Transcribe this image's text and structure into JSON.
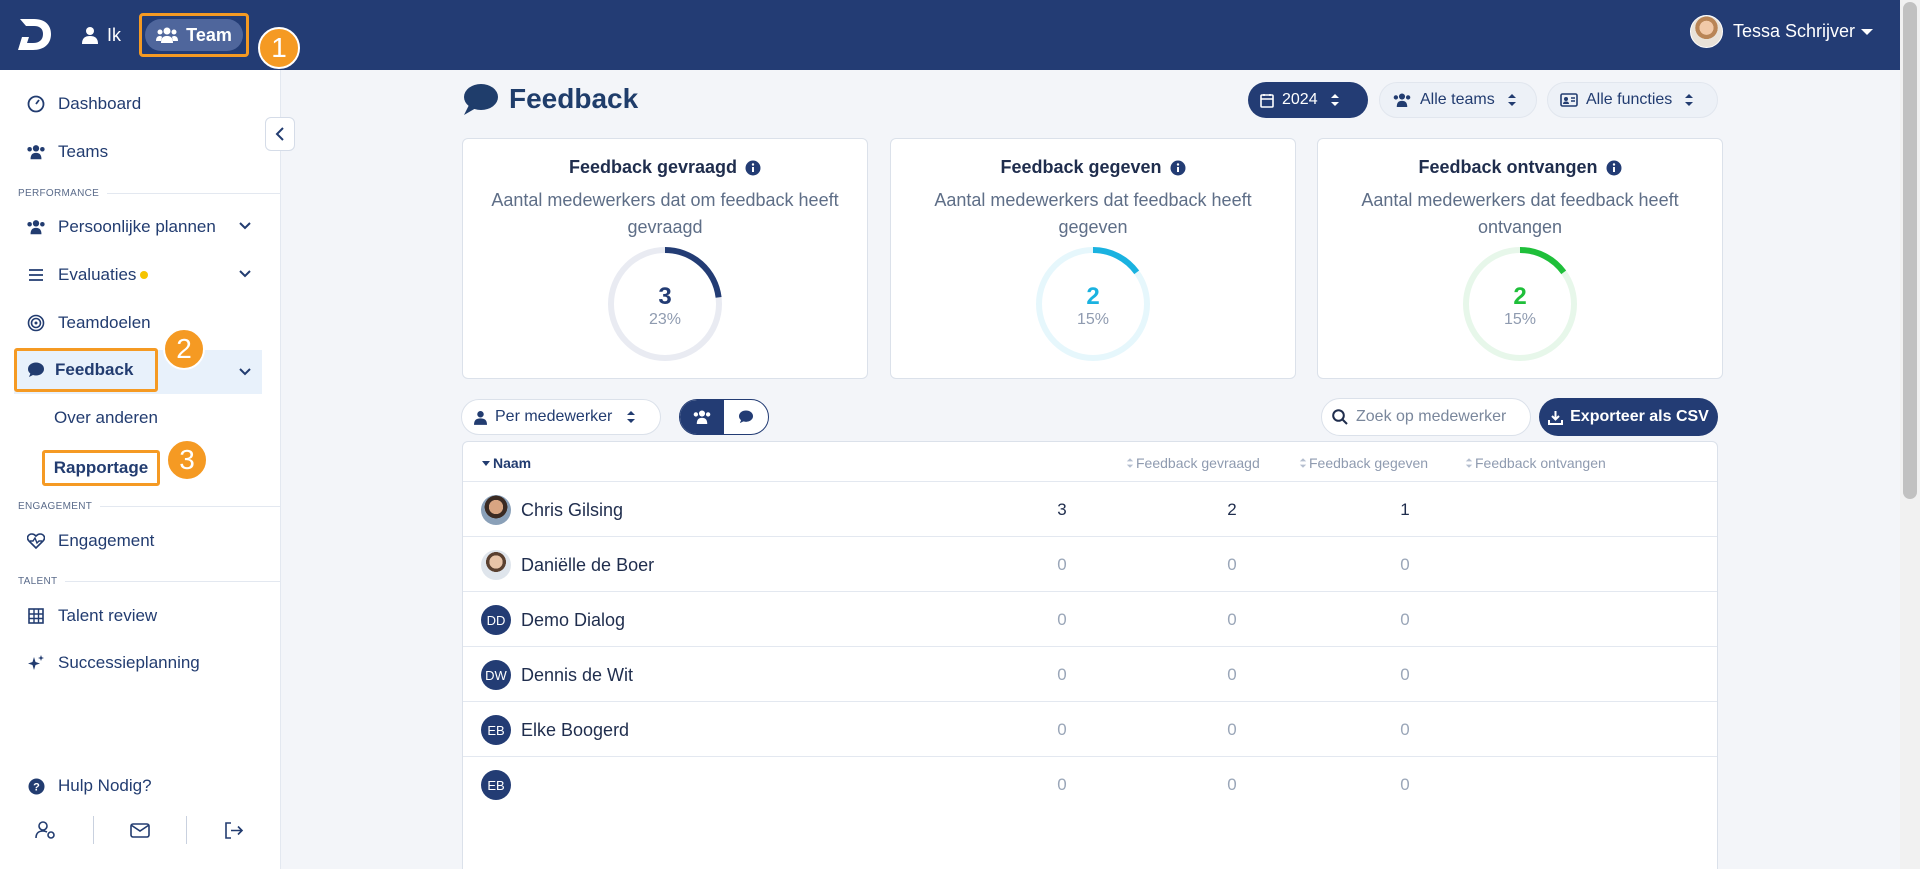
{
  "topbar": {
    "logo": "D",
    "nav": [
      {
        "label": "Ik",
        "icon": "user-icon"
      },
      {
        "label": "Team",
        "icon": "users-icon",
        "active": true
      }
    ],
    "user_name": "Tessa Schrijver",
    "accent": "#233c74"
  },
  "annotations": {
    "badge1": "1",
    "badge2": "2",
    "badge3": "3",
    "highlight_color": "#f59a23"
  },
  "sidebar": {
    "dashboard": "Dashboard",
    "teams": "Teams",
    "section_performance": "PERFORMANCE",
    "persoonlijke_plannen": "Persoonlijke plannen",
    "evaluaties": "Evaluaties",
    "teamdoelen": "Teamdoelen",
    "feedback": "Feedback",
    "over_anderen": "Over anderen",
    "rapportage": "Rapportage",
    "section_engagement": "ENGAGEMENT",
    "engagement": "Engagement",
    "section_talent": "TALENT",
    "talent_review": "Talent review",
    "successieplanning": "Successieplanning",
    "help": "Hulp Nodig?"
  },
  "header": {
    "title": "Feedback",
    "year": "2024",
    "teams": "Alle teams",
    "functies": "Alle functies"
  },
  "cards": [
    {
      "title": "Feedback gevraagd",
      "desc": "Aantal medewerkers dat om feedback heeft gevraagd",
      "value": "3",
      "percent": "23%",
      "fraction": 0.23,
      "color": "#233c74"
    },
    {
      "title": "Feedback gegeven",
      "desc": "Aantal medewerkers dat feedback heeft gegeven",
      "value": "2",
      "percent": "15%",
      "fraction": 0.15,
      "color": "#1ab2e0"
    },
    {
      "title": "Feedback ontvangen",
      "desc": "Aantal medewerkers dat feedback heeft ontvangen",
      "value": "2",
      "percent": "15%",
      "fraction": 0.15,
      "color": "#1fbf3a"
    }
  ],
  "controls": {
    "per": "Per medewerker",
    "search_placeholder": "Zoek op medewerker",
    "export": "Exporteer als CSV"
  },
  "table": {
    "columns": [
      "Naam",
      "Feedback gevraagd",
      "Feedback gegeven",
      "Feedback ontvangen"
    ],
    "rows": [
      {
        "initials": "",
        "name": "Chris Gilsing",
        "gevraagd": "3",
        "gegeven": "2",
        "ontvangen": "1"
      },
      {
        "initials": "",
        "name": "Daniëlle de Boer",
        "gevraagd": "0",
        "gegeven": "0",
        "ontvangen": "0"
      },
      {
        "initials": "DD",
        "name": "Demo Dialog",
        "gevraagd": "0",
        "gegeven": "0",
        "ontvangen": "0"
      },
      {
        "initials": "DW",
        "name": "Dennis de Wit",
        "gevraagd": "0",
        "gegeven": "0",
        "ontvangen": "0"
      },
      {
        "initials": "EB",
        "name": "Elke Boogerd",
        "gevraagd": "0",
        "gegeven": "0",
        "ontvangen": "0"
      },
      {
        "initials": "EB",
        "name": "",
        "gevraagd": "0",
        "gegeven": "0",
        "ontvangen": "0"
      }
    ]
  }
}
